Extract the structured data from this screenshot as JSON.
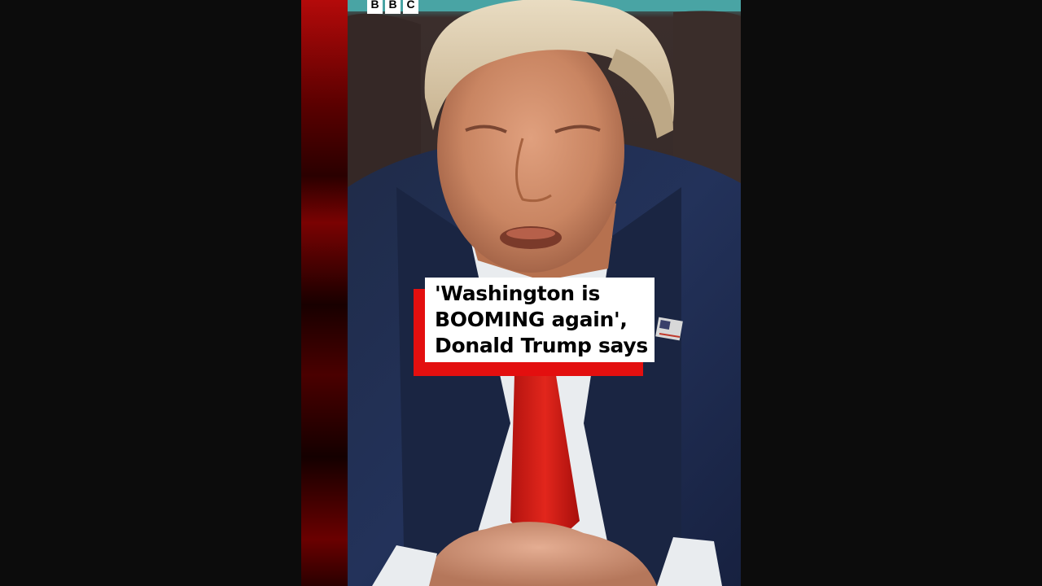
{
  "player": {
    "brand": {
      "letters": [
        "B",
        "B",
        "C"
      ],
      "icon": "bbc-logo"
    },
    "caption": {
      "lines": [
        "'Washington is",
        "BOOMING again',",
        "Donald Trump says"
      ]
    },
    "colors": {
      "background": "#0c0c0c",
      "accent_red": "#e30f0f",
      "caption_bg": "#ffffff",
      "caption_text": "#000000"
    }
  }
}
